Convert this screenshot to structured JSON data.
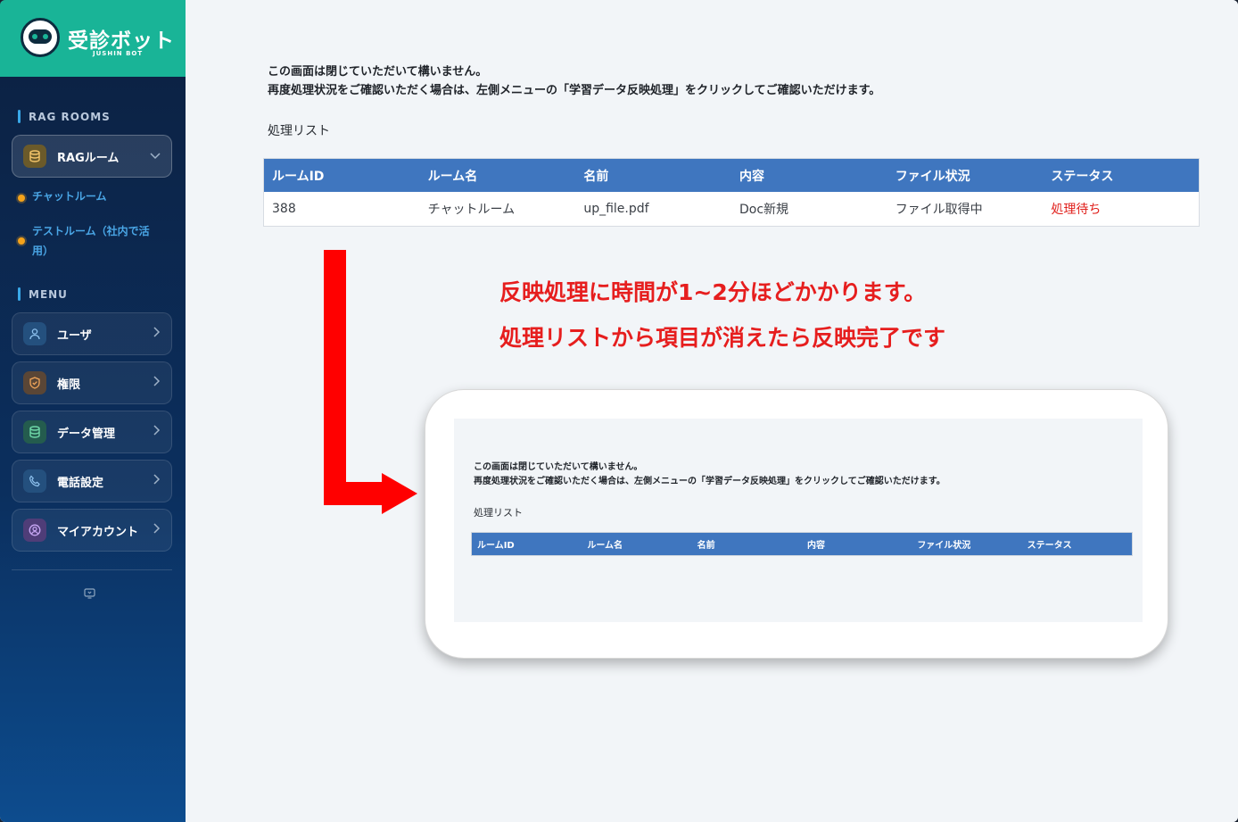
{
  "brand": {
    "title": "受診ボット",
    "subtitle": "JUSHIN BOT"
  },
  "sidebar": {
    "rag_section_label": "RAG ROOMS",
    "rag_room_button": "RAGルーム",
    "rooms": [
      {
        "label": "チャットルーム"
      },
      {
        "label": "テストルーム（社内で活用）"
      }
    ],
    "menu_section_label": "MENU",
    "menu_items": [
      {
        "label": "ユーザ",
        "icon": "user-icon",
        "color": "#3a6fa8"
      },
      {
        "label": "権限",
        "icon": "shield-icon",
        "color": "#c98a3c"
      },
      {
        "label": "データ管理",
        "icon": "database-icon",
        "color": "#3c9a6e"
      },
      {
        "label": "電話設定",
        "icon": "phone-icon",
        "color": "#3a6fa8"
      },
      {
        "label": "マイアカウント",
        "icon": "account-icon",
        "color": "#8a5fc4"
      }
    ]
  },
  "main": {
    "notice_line1": "この画面は閉じていただいて構いません。",
    "notice_line2": "再度処理状況をご確認いただく場合は、左側メニューの「学習データ反映処理」をクリックしてご確認いただけます。",
    "list_title": "処理リスト",
    "table": {
      "headers": [
        "ルームID",
        "ルーム名",
        "名前",
        "内容",
        "ファイル状況",
        "ステータス"
      ],
      "rows": [
        {
          "room_id": "388",
          "room_name": "チャットルーム",
          "name": "up_file.pdf",
          "content": "Doc新規",
          "file_status": "ファイル取得中",
          "status": "処理待ち"
        }
      ]
    },
    "callout_line1": "反映処理に時間が1~2分ほどかかります。",
    "callout_line2": "処理リストから項目が消えたら反映完了です"
  },
  "preview": {
    "notice_line1": "この画面は閉じていただいて構いません。",
    "notice_line2": "再度処理状況をご確認いただく場合は、左側メニューの「学習データ反映処理」をクリックしてご確認いただけます。",
    "list_title": "処理リスト",
    "headers": [
      "ルームID",
      "ルーム名",
      "名前",
      "内容",
      "ファイル状況",
      "ステータス"
    ]
  },
  "colors": {
    "brand": "#19b497",
    "table_header": "#3f76bf",
    "status_red": "#e0201c",
    "callout_red": "#e61e1e",
    "arrow_red": "#ff0000"
  }
}
